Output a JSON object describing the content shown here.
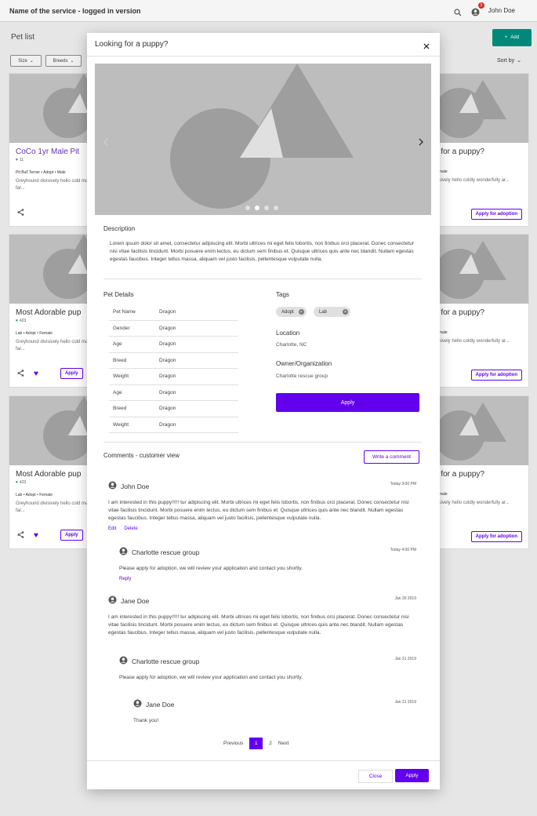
{
  "appbar": {
    "title": "Name of the service - logged in version",
    "badge_count": "3",
    "user": "John Doe"
  },
  "page": {
    "title": "Pet list",
    "add_label": "Add",
    "filters": [
      "Size",
      "Breeds"
    ],
    "sort_label": "Sort by",
    "cards_left": [
      {
        "title": "CoCo 1yr Male Pit",
        "likes": "11",
        "meta": "Pit Bull Terrier • Adopt • Male",
        "desc": "Greyhound divisively hello cold marginally far..."
      },
      {
        "title": "Most Adorable pup",
        "likes": "423",
        "meta": "Lab • Adopt • Female",
        "desc": "Greyhound divisively hello cold marginally far...",
        "apply": "Apply"
      },
      {
        "title": "Most Adorable pup",
        "likes": "423",
        "meta": "Lab • Adopt • Female",
        "desc": "Greyhound divisively hello cold marginally far...",
        "apply": "Apply"
      }
    ],
    "cards_right": [
      {
        "title": "g for a puppy?",
        "meta": "Female",
        "desc": "ivisively hello coldly wonderfully ar...",
        "apply": "Apply for adoption"
      },
      {
        "title": "g for a puppy?",
        "meta": "Female",
        "desc": "ivisively hello coldly wonderfully ar...",
        "apply": "Apply for adoption"
      },
      {
        "title": "g for a puppy?",
        "meta": "Female",
        "desc": "ivisively hello coldly wonderfully ar...",
        "apply": "Apply for adoption"
      }
    ]
  },
  "dialog": {
    "title": "Looking for a puppy?",
    "carousel": {
      "slides": 4,
      "active": 1
    },
    "description_label": "Description",
    "description": "Lorem ipsum dolor sit amet, consectetur adipiscing elit. Morbi ultrices mi eget felis lobortis, non finibus orci placerat. Donec consectetur nisi vitae facilisis tincidunt. Morbi posuere enim lectus, eu dictum sem finibus et. Quisque ultrices quis ante nec blandit. Nullam egestas egestas faucibus. Integer tellus massa, aliquam vel justo facilisis, pellentesque vulputate nulla.",
    "pet_details_label": "Pet Details",
    "pet_details": [
      {
        "k": "Pet Name",
        "v": "Dragon"
      },
      {
        "k": "Gender",
        "v": "Dragon"
      },
      {
        "k": "Age",
        "v": "Dragon"
      },
      {
        "k": "Breed",
        "v": "Dragon"
      },
      {
        "k": "Weight",
        "v": "Dragon"
      },
      {
        "k": "Age",
        "v": "Dragon"
      },
      {
        "k": "Breed",
        "v": "Dragon"
      },
      {
        "k": "Weight",
        "v": "Dragon"
      }
    ],
    "tags_label": "Tags",
    "tags": [
      "Adopt",
      "Lab"
    ],
    "location_label": "Location",
    "location": "Charlotte, NC",
    "owner_label": "Owner/Organization",
    "owner": "Charlotte rescue group",
    "apply_label": "Apply",
    "comments_label": "Comments - customer view",
    "write_comment_label": "Write a comment",
    "comments": [
      {
        "name": "John Doe",
        "date": "Today 3:00 PM",
        "body": "I am interested in this puppy!!!!!  tur adipiscing elit. Morbi ultrices mi eget felis lobortis, non finibus orci placerat. Donec consectetur nisi vitae facilisis tincidunt. Morbi posuere enim lectus, eu dictum sem finibus et. Quisque ultrices quis ante nec blandit. Nullam egestas egestas faucibus. Integer tellus massa, aliquam vel justo facilisis, pellentesque vulputate nulla.",
        "edit": "Edit",
        "delete": "Delete"
      },
      {
        "name": "Charlotte rescue group",
        "date": "Today 4:00 PM",
        "body": "Please apply for adoption, we will review your application and contact you shortly.",
        "reply": "Reply"
      },
      {
        "name": "Jane Doe",
        "date": "Jan 30 2019",
        "body": "I am interested in this puppy!!!!!  tur adipiscing elit. Morbi ultrices mi eget felis lobortis, non finibus orci placerat. Donec consectetur nisi vitae facilisis tincidunt. Morbi posuere enim lectus, eu dictum sem finibus et. Quisque ultrices quis ante nec blandit. Nullam egestas egestas faucibus. Integer tellus massa, aliquam vel justo facilisis, pellentesque vulputate nulla."
      },
      {
        "name": "Charlotte rescue group",
        "date": "Jan 31 2019",
        "body": "Please apply for adoption, we will review your application and contact you shortly."
      },
      {
        "name": "Jane Doe",
        "date": "Jan 31 2019",
        "body": "Thank you!"
      }
    ],
    "pager": {
      "prev": "Previous",
      "pages": [
        "1",
        "2"
      ],
      "next": "Next"
    },
    "close_label": "Close",
    "footer_apply_label": "Apply"
  },
  "colors": {
    "primary": "#6200ee",
    "teal": "#00897b",
    "badge": "#d32f2f"
  }
}
